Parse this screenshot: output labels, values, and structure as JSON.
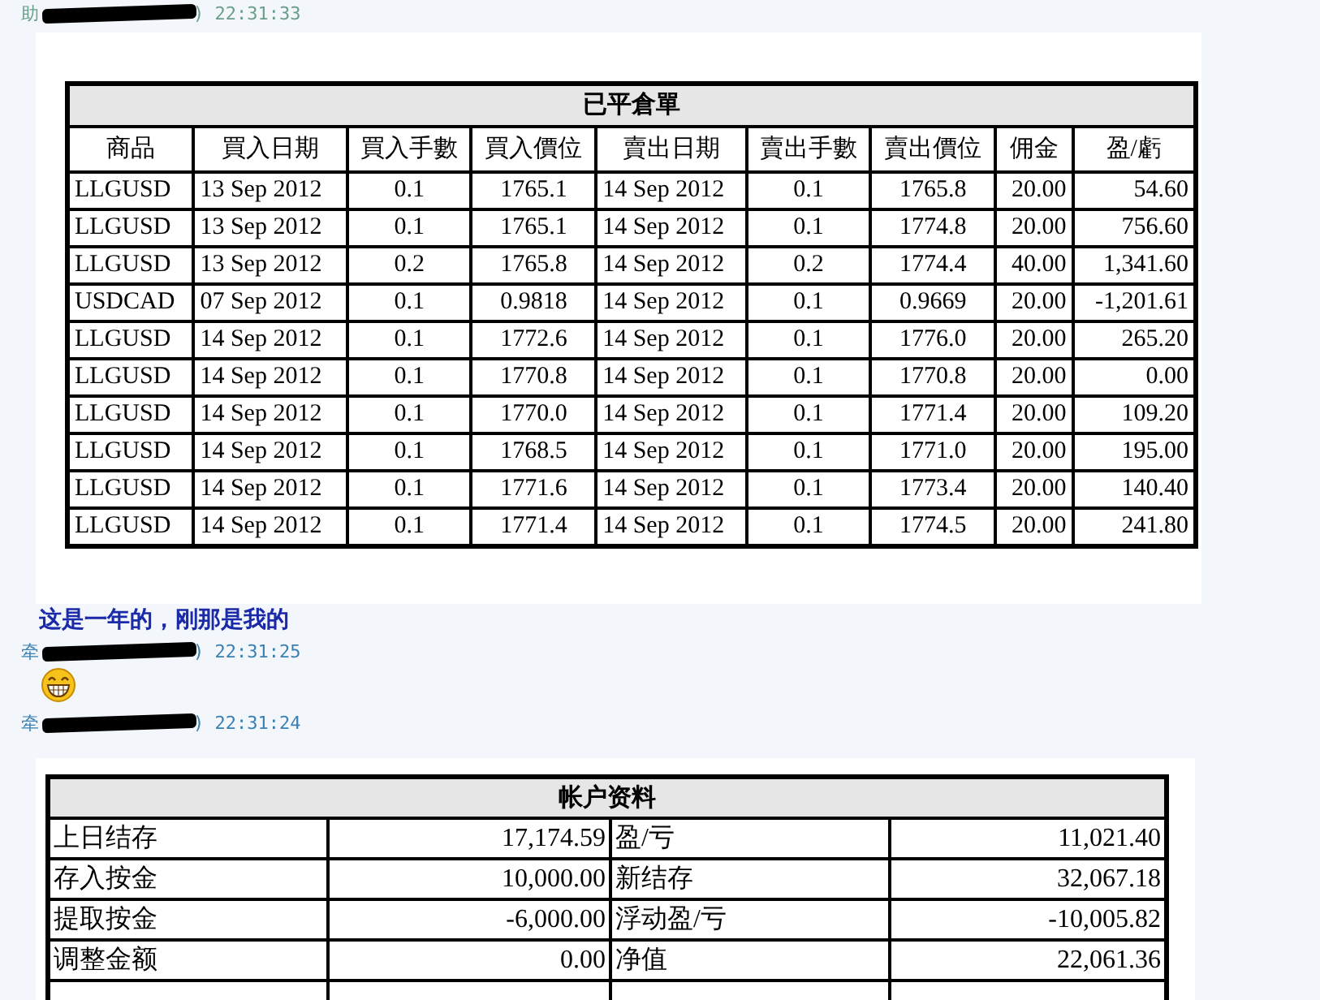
{
  "chat": [
    {
      "kind": "header",
      "sender": "助",
      "time": ") 22:31:33",
      "color": "#6a9e8a"
    },
    {
      "kind": "trades",
      "title": "已平倉單",
      "columns": [
        "商品",
        "買入日期",
        "買入手數",
        "買入價位",
        "賣出日期",
        "賣出手數",
        "賣出價位",
        "佣金",
        "盈/虧"
      ],
      "rows": [
        [
          "LLGUSD",
          "13 Sep 2012",
          "0.1",
          "1765.1",
          "14 Sep 2012",
          "0.1",
          "1765.8",
          "20.00",
          "54.60"
        ],
        [
          "LLGUSD",
          "13 Sep 2012",
          "0.1",
          "1765.1",
          "14 Sep 2012",
          "0.1",
          "1774.8",
          "20.00",
          "756.60"
        ],
        [
          "LLGUSD",
          "13 Sep 2012",
          "0.2",
          "1765.8",
          "14 Sep 2012",
          "0.2",
          "1774.4",
          "40.00",
          "1,341.60"
        ],
        [
          "USDCAD",
          "07 Sep 2012",
          "0.1",
          "0.9818",
          "14 Sep 2012",
          "0.1",
          "0.9669",
          "20.00",
          "-1,201.61"
        ],
        [
          "LLGUSD",
          "14 Sep 2012",
          "0.1",
          "1772.6",
          "14 Sep 2012",
          "0.1",
          "1776.0",
          "20.00",
          "265.20"
        ],
        [
          "LLGUSD",
          "14 Sep 2012",
          "0.1",
          "1770.8",
          "14 Sep 2012",
          "0.1",
          "1770.8",
          "20.00",
          "0.00"
        ],
        [
          "LLGUSD",
          "14 Sep 2012",
          "0.1",
          "1770.0",
          "14 Sep 2012",
          "0.1",
          "1771.4",
          "20.00",
          "109.20"
        ],
        [
          "LLGUSD",
          "14 Sep 2012",
          "0.1",
          "1768.5",
          "14 Sep 2012",
          "0.1",
          "1771.0",
          "20.00",
          "195.00"
        ],
        [
          "LLGUSD",
          "14 Sep 2012",
          "0.1",
          "1771.6",
          "14 Sep 2012",
          "0.1",
          "1773.4",
          "20.00",
          "140.40"
        ],
        [
          "LLGUSD",
          "14 Sep 2012",
          "0.1",
          "1771.4",
          "14 Sep 2012",
          "0.1",
          "1774.5",
          "20.00",
          "241.80"
        ]
      ]
    },
    {
      "kind": "text",
      "text": "这是一年的，刚那是我的"
    },
    {
      "kind": "header",
      "sender": "牵",
      "time": ") 22:31:25",
      "color": "#3b7fb0"
    },
    {
      "kind": "emoji"
    },
    {
      "kind": "header",
      "sender": "牵",
      "time": ") 22:31:24",
      "color": "#3b7fb0"
    },
    {
      "kind": "account",
      "title": "帐户资料",
      "rows": [
        [
          "上日结存",
          "17,174.59",
          "盈/亏",
          "11,021.40"
        ],
        [
          "存入按金",
          "10,000.00",
          "新结存",
          "32,067.18"
        ],
        [
          "提取按金",
          "-6,000.00",
          "浮动盈/亏",
          "-10,005.82"
        ],
        [
          "调整金额",
          "0.00",
          "净值",
          "22,061.36"
        ]
      ]
    }
  ]
}
